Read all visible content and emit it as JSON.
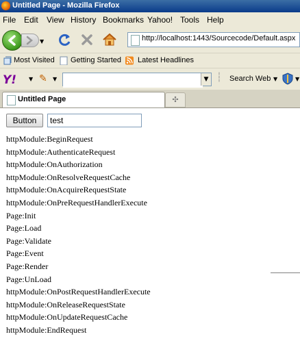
{
  "window": {
    "title": "Untitled Page - Mozilla Firefox"
  },
  "menu": [
    "File",
    "Edit",
    "View",
    "History",
    "Bookmarks",
    "Yahoo!",
    "Tools",
    "Help"
  ],
  "navigation": {
    "url": "http://localhost:1443/Sourcecode/Default.aspx"
  },
  "bookmarks": [
    "Most Visited",
    "Getting Started",
    "Latest Headlines"
  ],
  "yahoo_toolbar": {
    "logo": "Y!",
    "search_value": "",
    "search_web_label": "Search Web"
  },
  "tabs": [
    {
      "label": "Untitled Page"
    }
  ],
  "page": {
    "button_label": "Button",
    "textbox_value": "test",
    "lines": [
      "httpModule:BeginRequest",
      "httpModule:AuthenticateRequest",
      "httpModule:OnAuthorization",
      "httpModule:OnResolveRequestCache",
      "httpModule:OnAcquireRequestState",
      "httpModule:OnPreRequestHandlerExecute",
      "Page:Init",
      "Page:Load",
      "Page:Validate",
      "Page:Event",
      "Page:Render",
      "Page:UnLoad",
      "httpModule:OnPostRequestHandlerExecute",
      "httpModule:OnReleaseRequestState",
      "httpModule:OnUpdateRequestCache",
      "httpModule:EndRequest"
    ]
  },
  "icons": {
    "firefox": "firefox-icon",
    "back": "back-arrow-icon",
    "forward": "forward-arrow-icon",
    "reload": "reload-icon",
    "stop": "stop-icon",
    "home": "home-icon",
    "page": "page-icon",
    "rss": "rss-icon"
  },
  "colors": {
    "titlebar": "#0a3b8a",
    "chrome": "#ece9d8",
    "yahoo": "#7b0099",
    "back_button": "#3d9a1c"
  }
}
